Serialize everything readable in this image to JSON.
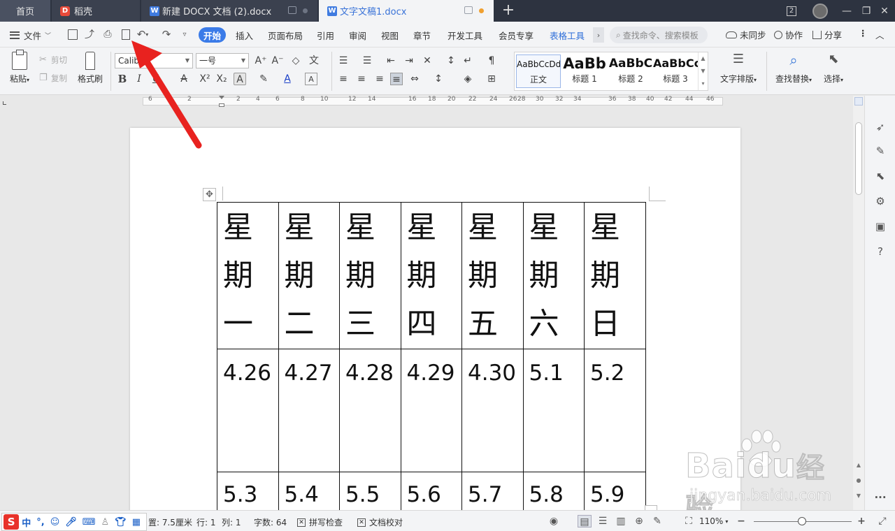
{
  "tabbar": {
    "home": "首页",
    "tabs": [
      {
        "label": "稻壳",
        "icon": "daoke-icon"
      },
      {
        "label": "新建 DOCX 文档 (2).docx",
        "icon": "wps-writer-icon"
      },
      {
        "label": "文字文稿1.docx",
        "icon": "wps-writer-icon"
      }
    ],
    "window_count": "2",
    "add": "+"
  },
  "menubar": {
    "file": "文件",
    "tabs": [
      "开始",
      "插入",
      "页面布局",
      "引用",
      "审阅",
      "视图",
      "章节",
      "开发工具",
      "会员专享",
      "表格工具"
    ],
    "search_placeholder": "查找命令、搜索模板",
    "sync": "未同步",
    "collab": "协作",
    "share": "分享"
  },
  "ribbon": {
    "paste": "粘贴",
    "cut": "剪切",
    "copy": "复制",
    "format_painter": "格式刷",
    "font_name": "Calibri",
    "font_size": "一号",
    "styles": [
      {
        "sample": "AaBbCcDd",
        "name": "正文"
      },
      {
        "sample": "AaBb",
        "name": "标题 1"
      },
      {
        "sample": "AaBbC",
        "name": "标题 2"
      },
      {
        "sample": "AaBbCc",
        "name": "标题 3"
      }
    ],
    "text_layout": "文字排版",
    "find_replace": "查找替换",
    "select": "选择"
  },
  "ruler": {
    "numbers": [
      "6",
      "4",
      "2",
      "2",
      "4",
      "6",
      "8",
      "10",
      "12",
      "14",
      "16",
      "18",
      "20",
      "22",
      "24",
      "26",
      "28",
      "30",
      "32",
      "34",
      "36",
      "38",
      "40",
      "42",
      "44",
      "46"
    ]
  },
  "table": {
    "header": [
      [
        "星",
        "期",
        "一"
      ],
      [
        "星",
        "期",
        "二"
      ],
      [
        "星",
        "期",
        "三"
      ],
      [
        "星",
        "期",
        "四"
      ],
      [
        "星",
        "期",
        "五"
      ],
      [
        "星",
        "期",
        "六"
      ],
      [
        "星",
        "期",
        "日"
      ]
    ],
    "row1": [
      "4.26",
      "4.27",
      "4.28",
      "4.29",
      "4.30",
      "5.1",
      "5.2"
    ],
    "row2": [
      "5.3",
      "5.4",
      "5.5",
      "5.6",
      "5.7",
      "5.8",
      "5.9"
    ]
  },
  "statusbar": {
    "position": "置: 7.5厘米",
    "line": "行: 1",
    "col": "列: 1",
    "word_count": "字数: 64",
    "spell_check": "拼写检查",
    "doc_proof": "文档校对",
    "zoom": "110%"
  },
  "ime": {
    "items": [
      "中",
      "°,"
    ]
  },
  "watermark": {
    "brand": "Bai",
    "brand2": "du",
    "cn": "经验",
    "url": "jingyan.baidu.com"
  },
  "colors": {
    "accent": "#3b7be8",
    "tab_bar": "#2d3340",
    "arrow": "#e8221f"
  }
}
